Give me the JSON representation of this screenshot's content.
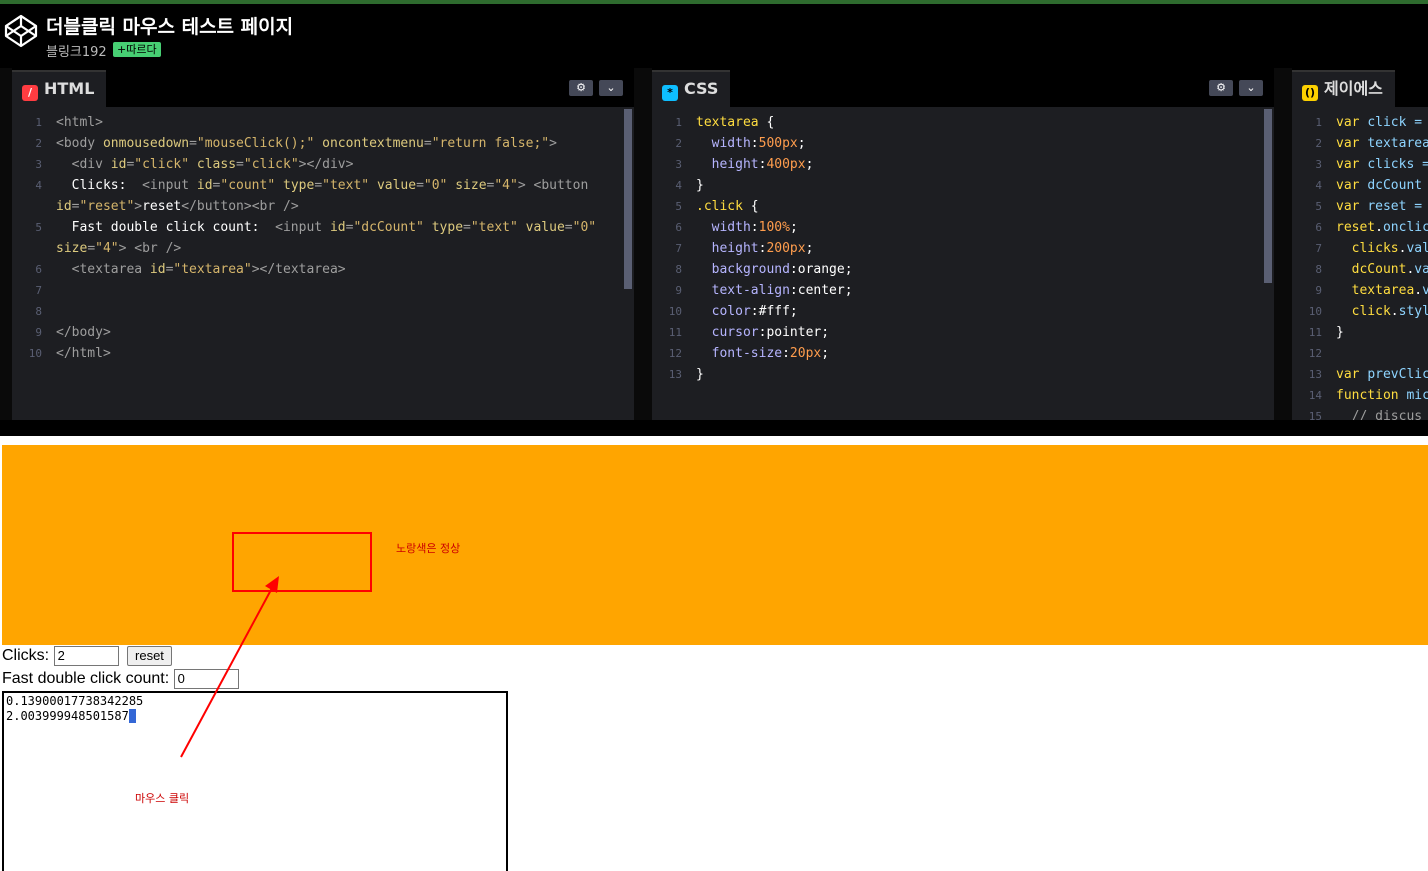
{
  "header": {
    "title": "더블클릭 마우스 테스트 페이지",
    "author": "블링크192",
    "follow_label": "+따르다"
  },
  "html_pane": {
    "tab_label": "HTML",
    "lines": [
      [
        {
          "c": "g",
          "t": "<html>"
        }
      ],
      [
        {
          "c": "g",
          "t": "<body "
        },
        {
          "c": "a",
          "t": "onmousedown"
        },
        {
          "c": "g",
          "t": "="
        },
        {
          "c": "v",
          "t": "\"mouseClick();\""
        },
        {
          "c": "g",
          "t": " "
        },
        {
          "c": "a",
          "t": "oncontextmenu"
        },
        {
          "c": "g",
          "t": "="
        },
        {
          "c": "v",
          "t": "\"return false;\""
        },
        {
          "c": "g",
          "t": ">"
        }
      ],
      [
        {
          "c": "g",
          "t": "  <div "
        },
        {
          "c": "a",
          "t": "id"
        },
        {
          "c": "g",
          "t": "="
        },
        {
          "c": "v",
          "t": "\"click\""
        },
        {
          "c": "g",
          "t": " "
        },
        {
          "c": "a",
          "t": "class"
        },
        {
          "c": "g",
          "t": "="
        },
        {
          "c": "v",
          "t": "\"click\""
        },
        {
          "c": "g",
          "t": "></div>"
        }
      ],
      [
        {
          "c": "w",
          "t": "  Clicks:  "
        },
        {
          "c": "g",
          "t": "<input "
        },
        {
          "c": "a",
          "t": "id"
        },
        {
          "c": "g",
          "t": "="
        },
        {
          "c": "v",
          "t": "\"count\""
        },
        {
          "c": "g",
          "t": " "
        },
        {
          "c": "a",
          "t": "type"
        },
        {
          "c": "g",
          "t": "="
        },
        {
          "c": "v",
          "t": "\"text\""
        },
        {
          "c": "g",
          "t": " "
        },
        {
          "c": "a",
          "t": "value"
        },
        {
          "c": "g",
          "t": "="
        },
        {
          "c": "v",
          "t": "\"0\""
        },
        {
          "c": "g",
          "t": " "
        },
        {
          "c": "a",
          "t": "size"
        },
        {
          "c": "g",
          "t": "="
        },
        {
          "c": "v",
          "t": "\"4\""
        },
        {
          "c": "g",
          "t": "> <button"
        }
      ],
      [
        {
          "c": "a",
          "t": "id"
        },
        {
          "c": "g",
          "t": "="
        },
        {
          "c": "v",
          "t": "\"reset\""
        },
        {
          "c": "g",
          "t": ">"
        },
        {
          "c": "w",
          "t": "reset"
        },
        {
          "c": "g",
          "t": "</button><br />"
        }
      ],
      [
        {
          "c": "w",
          "t": "  Fast double click count:  "
        },
        {
          "c": "g",
          "t": "<input "
        },
        {
          "c": "a",
          "t": "id"
        },
        {
          "c": "g",
          "t": "="
        },
        {
          "c": "v",
          "t": "\"dcCount\""
        },
        {
          "c": "g",
          "t": " "
        },
        {
          "c": "a",
          "t": "type"
        },
        {
          "c": "g",
          "t": "="
        },
        {
          "c": "v",
          "t": "\"text\""
        },
        {
          "c": "g",
          "t": " "
        },
        {
          "c": "a",
          "t": "value"
        },
        {
          "c": "g",
          "t": "="
        },
        {
          "c": "v",
          "t": "\"0\""
        }
      ],
      [
        {
          "c": "a",
          "t": "size"
        },
        {
          "c": "g",
          "t": "="
        },
        {
          "c": "v",
          "t": "\"4\""
        },
        {
          "c": "g",
          "t": "> <br />"
        }
      ],
      [
        {
          "c": "g",
          "t": "  <textarea "
        },
        {
          "c": "a",
          "t": "id"
        },
        {
          "c": "g",
          "t": "="
        },
        {
          "c": "v",
          "t": "\"textarea\""
        },
        {
          "c": "g",
          "t": "></textarea>"
        }
      ],
      [],
      [],
      [
        {
          "c": "g",
          "t": "</body>"
        }
      ],
      [
        {
          "c": "g",
          "t": "</html>"
        }
      ]
    ],
    "numbers": [
      "1",
      "2",
      "3",
      "4",
      "",
      "5",
      "",
      "6",
      "7",
      "8",
      "9",
      "10"
    ]
  },
  "css_pane": {
    "tab_label": "CSS",
    "lines": [
      [
        {
          "c": "cs",
          "t": "textarea"
        },
        {
          "c": "w",
          "t": " {"
        }
      ],
      [
        {
          "c": "pr",
          "t": "  width"
        },
        {
          "c": "w",
          "t": ":"
        },
        {
          "c": "num",
          "t": "500px"
        },
        {
          "c": "w",
          "t": ";"
        }
      ],
      [
        {
          "c": "pr",
          "t": "  height"
        },
        {
          "c": "w",
          "t": ":"
        },
        {
          "c": "num",
          "t": "400px"
        },
        {
          "c": "w",
          "t": ";"
        }
      ],
      [
        {
          "c": "w",
          "t": "}"
        }
      ],
      [
        {
          "c": "cs",
          "t": ".click"
        },
        {
          "c": "w",
          "t": " {"
        }
      ],
      [
        {
          "c": "pr",
          "t": "  width"
        },
        {
          "c": "w",
          "t": ":"
        },
        {
          "c": "num",
          "t": "100%"
        },
        {
          "c": "w",
          "t": ";"
        }
      ],
      [
        {
          "c": "pr",
          "t": "  height"
        },
        {
          "c": "w",
          "t": ":"
        },
        {
          "c": "num",
          "t": "200px"
        },
        {
          "c": "w",
          "t": ";"
        }
      ],
      [
        {
          "c": "pr",
          "t": "  background"
        },
        {
          "c": "w",
          "t": ":orange;"
        }
      ],
      [
        {
          "c": "pr",
          "t": "  text-align"
        },
        {
          "c": "w",
          "t": ":center;"
        }
      ],
      [
        {
          "c": "pr",
          "t": "  color"
        },
        {
          "c": "w",
          "t": ":#fff;"
        }
      ],
      [
        {
          "c": "pr",
          "t": "  cursor"
        },
        {
          "c": "w",
          "t": ":pointer;"
        }
      ],
      [
        {
          "c": "pr",
          "t": "  font-size"
        },
        {
          "c": "w",
          "t": ":"
        },
        {
          "c": "num",
          "t": "20px"
        },
        {
          "c": "w",
          "t": ";"
        }
      ],
      [
        {
          "c": "w",
          "t": "}"
        }
      ]
    ],
    "numbers": [
      "1",
      "2",
      "3",
      "4",
      "5",
      "6",
      "7",
      "8",
      "9",
      "10",
      "11",
      "12",
      "13"
    ]
  },
  "js_pane": {
    "tab_label": "제이에스",
    "lines": [
      [
        {
          "c": "cs",
          "t": "var "
        },
        {
          "c": "vr",
          "t": "click ="
        }
      ],
      [
        {
          "c": "cs",
          "t": "var "
        },
        {
          "c": "vr",
          "t": "textarea"
        }
      ],
      [
        {
          "c": "cs",
          "t": "var "
        },
        {
          "c": "vr",
          "t": "clicks ="
        }
      ],
      [
        {
          "c": "cs",
          "t": "var "
        },
        {
          "c": "vr",
          "t": "dcCount"
        }
      ],
      [
        {
          "c": "cs",
          "t": "var "
        },
        {
          "c": "vr",
          "t": "reset ="
        }
      ],
      [
        {
          "c": "cs",
          "t": "reset"
        },
        {
          "c": "w",
          "t": "."
        },
        {
          "c": "vr",
          "t": "onclic"
        }
      ],
      [
        {
          "c": "cs",
          "t": "  clicks"
        },
        {
          "c": "w",
          "t": "."
        },
        {
          "c": "vr",
          "t": "val"
        }
      ],
      [
        {
          "c": "cs",
          "t": "  dcCount"
        },
        {
          "c": "w",
          "t": "."
        },
        {
          "c": "vr",
          "t": "va"
        }
      ],
      [
        {
          "c": "cs",
          "t": "  textarea"
        },
        {
          "c": "w",
          "t": "."
        },
        {
          "c": "vr",
          "t": "v"
        }
      ],
      [
        {
          "c": "cs",
          "t": "  click"
        },
        {
          "c": "w",
          "t": "."
        },
        {
          "c": "vr",
          "t": "styl"
        }
      ],
      [
        {
          "c": "w",
          "t": "}"
        }
      ],
      [],
      [
        {
          "c": "cs",
          "t": "var "
        },
        {
          "c": "vr",
          "t": "prevClic"
        }
      ],
      [
        {
          "c": "cs",
          "t": "function "
        },
        {
          "c": "vr",
          "t": "mic"
        }
      ],
      [
        {
          "c": "g",
          "t": "  // discus"
        }
      ]
    ],
    "numbers": [
      "1",
      "2",
      "3",
      "4",
      "5",
      "6",
      "7",
      "8",
      "9",
      "10",
      "11",
      "12",
      "13",
      "14",
      "15"
    ]
  },
  "result": {
    "note_yellow": "노랑색은 정상",
    "note_click": "마우스 클릭",
    "clicks_label": "Clicks:",
    "clicks_value": "2",
    "reset_label": "reset",
    "dc_label": "Fast double click count:",
    "dc_value": "0",
    "textarea_lines": [
      "0.13900017738342285",
      "2.003999948501587"
    ]
  },
  "colors": {
    "orange": "#ffa500",
    "annotation_red": "#ff0000",
    "editor_bg": "#1d1e22"
  }
}
